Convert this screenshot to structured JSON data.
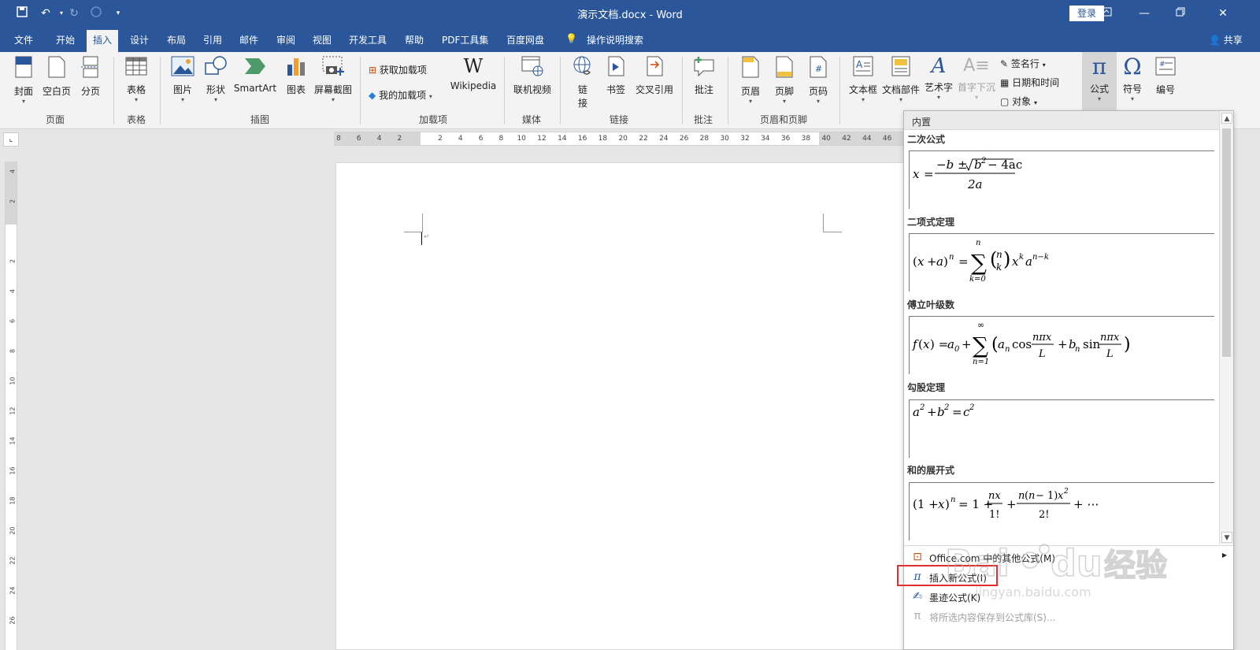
{
  "titlebar": {
    "title": "演示文档.docx  -  Word",
    "login": "登录"
  },
  "tabs": [
    "文件",
    "开始",
    "插入",
    "设计",
    "布局",
    "引用",
    "邮件",
    "审阅",
    "视图",
    "开发工具",
    "帮助",
    "PDF工具集",
    "百度网盘"
  ],
  "tell_me": "操作说明搜索",
  "share": "共享",
  "ribbon": {
    "pages": {
      "cover": "封面",
      "blank": "空白页",
      "break": "分页",
      "group": "页面"
    },
    "tables": {
      "table": "表格",
      "group": "表格"
    },
    "illustrations": {
      "picture": "图片",
      "shapes": "形状",
      "smartart": "SmartArt",
      "chart": "图表",
      "screenshot": "屏幕截图",
      "group": "插图"
    },
    "addins": {
      "get": "获取加载项",
      "mine": "我的加载项",
      "wikipedia": "Wikipedia",
      "group": "加载项"
    },
    "media": {
      "video": "联机视频",
      "group": "媒体"
    },
    "links": {
      "link1": "链",
      "link2": "接",
      "bookmark": "书签",
      "xref": "交叉引用",
      "group": "链接"
    },
    "comments": {
      "comment": "批注",
      "group": "批注"
    },
    "header_footer": {
      "header": "页眉",
      "footer": "页脚",
      "pagenum": "页码",
      "group": "页眉和页脚"
    },
    "text": {
      "textbox": "文本框",
      "parts": "文档部件",
      "wordart": "艺术字",
      "dropcap": "首字下沉",
      "sigline": "签名行",
      "datetime": "日期和时间",
      "object": "对象"
    },
    "symbols": {
      "equation": "公式",
      "symbol": "符号",
      "number": "编号"
    }
  },
  "hruler_ticks": [
    "8",
    "6",
    "4",
    "2",
    "",
    "2",
    "4",
    "6",
    "8",
    "10",
    "12",
    "14",
    "16",
    "18",
    "20",
    "22",
    "24",
    "26",
    "28",
    "30",
    "32",
    "34",
    "36",
    "38",
    "40",
    "42",
    "44",
    "46"
  ],
  "vruler_ticks": [
    "4",
    "2",
    "",
    "2",
    "4",
    "6",
    "8",
    "10",
    "12",
    "14",
    "16",
    "18",
    "20",
    "22",
    "24",
    "26"
  ],
  "equation_panel": {
    "header": "内置",
    "items": [
      {
        "title": "二次公式"
      },
      {
        "title": "二项式定理"
      },
      {
        "title": "傅立叶级数"
      },
      {
        "title": "勾股定理"
      },
      {
        "title": "和的展开式"
      }
    ],
    "menu": [
      {
        "label": "Office.com 中的其他公式(M)",
        "icon": "office-icon",
        "disabled": false
      },
      {
        "label": "插入新公式(I)",
        "icon": "pi-icon",
        "disabled": false
      },
      {
        "label": "墨迹公式(K)",
        "icon": "ink-equation-icon",
        "disabled": false
      },
      {
        "label": "将所选内容保存到公式库(S)...",
        "icon": "save-equation-icon",
        "disabled": true
      }
    ]
  },
  "watermark": "Baidu经验",
  "watermark_url": "jingyan.baidu.com"
}
